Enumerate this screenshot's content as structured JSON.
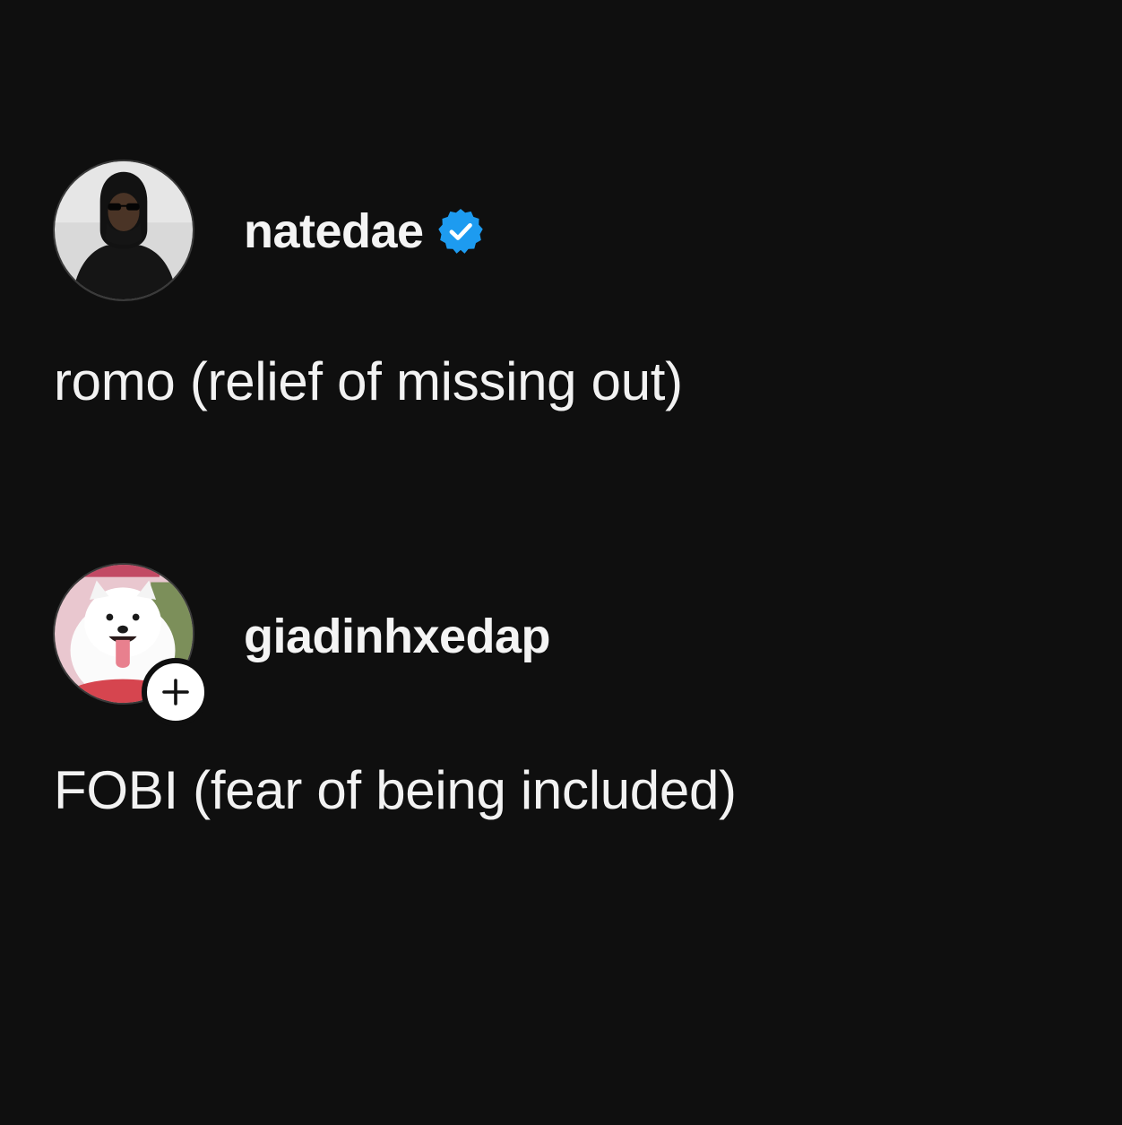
{
  "posts": [
    {
      "username": "natedae",
      "verified": true,
      "avatar_icon": "person-in-black-hood-avatar",
      "caption": "romo (relief of missing out)"
    },
    {
      "username": "giadinhxedap",
      "verified": false,
      "avatar_icon": "white-samoyed-dog-avatar",
      "follow_icon": "plus-icon",
      "caption": "FOBI (fear of being included)"
    }
  ],
  "colors": {
    "background": "#0f0f0f",
    "text": "#f2f2f2",
    "verified_badge": "#1d9bf0",
    "follow_badge": "#ffffff"
  }
}
